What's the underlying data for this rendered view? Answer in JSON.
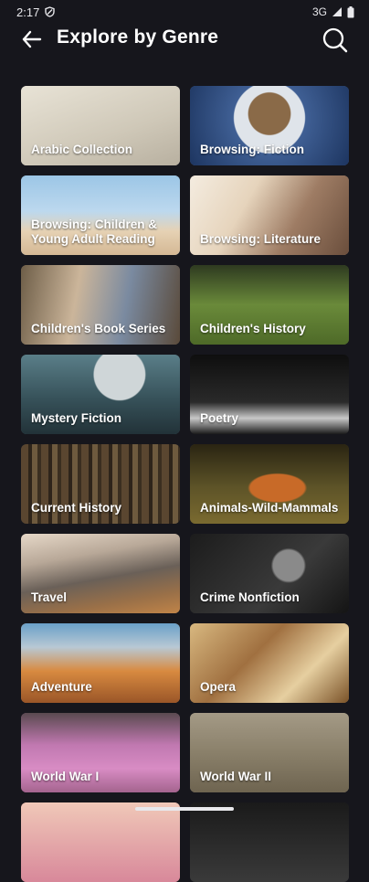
{
  "status_bar": {
    "time": "2:17",
    "network": "3G"
  },
  "header": {
    "title": "Explore by Genre",
    "back_icon": "arrow-left-icon",
    "search_icon": "search-icon"
  },
  "genres": [
    {
      "label": "Arabic Collection",
      "bg": "#cfc9bd"
    },
    {
      "label": "Browsing: Fiction",
      "bg": "#4a6a9a"
    },
    {
      "label": "Browsing: Children & Young Adult Reading",
      "bg": "#8bb6d8"
    },
    {
      "label": "Browsing: Literature",
      "bg": "#b89478"
    },
    {
      "label": "Children's Book Series",
      "bg": "#7a6a52"
    },
    {
      "label": "Children's History",
      "bg": "#4f6b2e"
    },
    {
      "label": "Mystery Fiction",
      "bg": "#3a5660"
    },
    {
      "label": "Poetry",
      "bg": "#1c1c1c"
    },
    {
      "label": "Current History",
      "bg": "#3e3428"
    },
    {
      "label": "Animals-Wild-Mammals",
      "bg": "#5a4a24"
    },
    {
      "label": "Travel",
      "bg": "#8a7460"
    },
    {
      "label": "Crime Nonfiction",
      "bg": "#262626"
    },
    {
      "label": "Adventure",
      "bg": "#c0763a"
    },
    {
      "label": "Opera",
      "bg": "#a07848"
    },
    {
      "label": "World War I",
      "bg": "#a0608a"
    },
    {
      "label": "World War II",
      "bg": "#867c68"
    },
    {
      "label": "",
      "bg": "#d88a80"
    },
    {
      "label": "",
      "bg": "#2a2a2a"
    }
  ]
}
